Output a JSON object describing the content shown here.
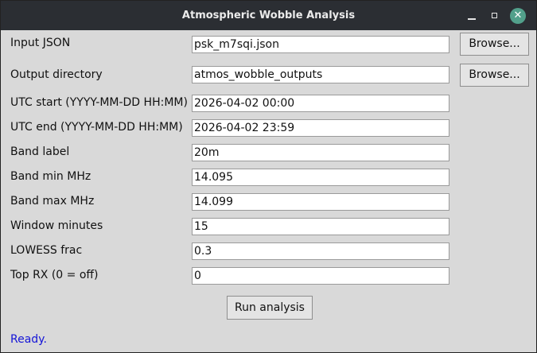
{
  "window": {
    "title": "Atmospheric Wobble Analysis"
  },
  "window_controls": {
    "minimize_icon": "minimize-icon",
    "maximize_icon": "maximize-icon",
    "close_icon": "close-icon",
    "close_glyph": "✕",
    "close_color": "#52a08b"
  },
  "form": {
    "input_json": {
      "label": "Input JSON",
      "value": "psk_m7sqi.json"
    },
    "output_dir": {
      "label": "Output directory",
      "value": "atmos_wobble_outputs"
    },
    "utc_start": {
      "label": "UTC start (YYYY-MM-DD HH:MM)",
      "value": "2026-04-02 00:00"
    },
    "utc_end": {
      "label": "UTC end (YYYY-MM-DD HH:MM)",
      "value": "2026-04-02 23:59"
    },
    "band_label": {
      "label": "Band label",
      "value": "20m"
    },
    "band_min": {
      "label": "Band min MHz",
      "value": "14.095"
    },
    "band_max": {
      "label": "Band max MHz",
      "value": "14.099"
    },
    "window_minutes": {
      "label": "Window minutes",
      "value": "15"
    },
    "lowess_frac": {
      "label": "LOWESS frac",
      "value": "0.3"
    },
    "top_rx": {
      "label": "Top RX (0 = off)",
      "value": "0"
    }
  },
  "buttons": {
    "browse_input": "Browse...",
    "browse_output": "Browse...",
    "run": "Run analysis"
  },
  "status": {
    "text": "Ready.",
    "color": "#1515d8"
  }
}
